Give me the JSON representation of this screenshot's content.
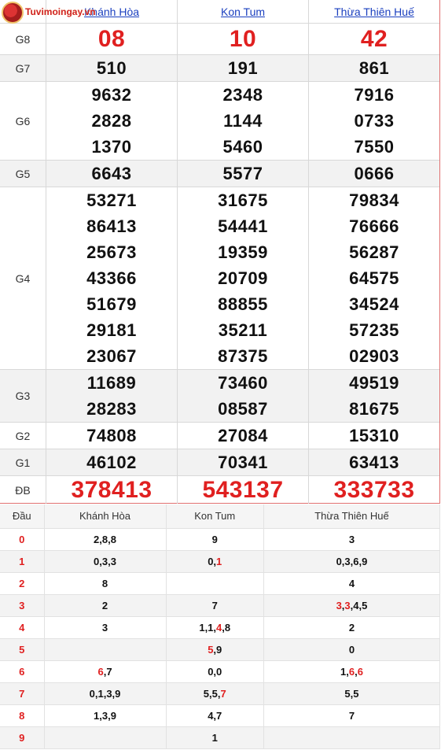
{
  "logo": {
    "text": "Tuvimoingay.vn"
  },
  "provinces": [
    "Khánh Hòa",
    "Kon Tum",
    "Thừa Thiên Huế"
  ],
  "prizes": [
    {
      "label": "G8",
      "values": [
        [
          "08"
        ],
        [
          "10"
        ],
        [
          "42"
        ]
      ]
    },
    {
      "label": "G7",
      "values": [
        [
          "510"
        ],
        [
          "191"
        ],
        [
          "861"
        ]
      ]
    },
    {
      "label": "G6",
      "values": [
        [
          "9632",
          "2828",
          "1370"
        ],
        [
          "2348",
          "1144",
          "5460"
        ],
        [
          "7916",
          "0733",
          "7550"
        ]
      ]
    },
    {
      "label": "G5",
      "values": [
        [
          "6643"
        ],
        [
          "5577"
        ],
        [
          "0666"
        ]
      ]
    },
    {
      "label": "G4",
      "values": [
        [
          "53271",
          "86413",
          "25673",
          "43366",
          "51679",
          "29181",
          "23067"
        ],
        [
          "31675",
          "54441",
          "19359",
          "20709",
          "88855",
          "35211",
          "87375"
        ],
        [
          "79834",
          "76666",
          "56287",
          "64575",
          "34524",
          "57235",
          "02903"
        ]
      ]
    },
    {
      "label": "G3",
      "values": [
        [
          "11689",
          "28283"
        ],
        [
          "73460",
          "08587"
        ],
        [
          "49519",
          "81675"
        ]
      ]
    },
    {
      "label": "G2",
      "values": [
        [
          "74808"
        ],
        [
          "27084"
        ],
        [
          "15310"
        ]
      ]
    },
    {
      "label": "G1",
      "values": [
        [
          "46102"
        ],
        [
          "70341"
        ],
        [
          "63413"
        ]
      ]
    },
    {
      "label": "ĐB",
      "values": [
        [
          "378413"
        ],
        [
          "543137"
        ],
        [
          "333733"
        ]
      ]
    }
  ],
  "dau_table": {
    "header": [
      "Đầu",
      "Khánh Hòa",
      "Kon Tum",
      "Thừa Thiên Huế"
    ],
    "rows": [
      {
        "dau": "0",
        "values": [
          "2,8,8",
          "9",
          "3"
        ]
      },
      {
        "dau": "1",
        "values": [
          "0,3,3",
          "0,1",
          "0,3,6,9"
        ]
      },
      {
        "dau": "2",
        "values": [
          "8",
          "",
          "4"
        ]
      },
      {
        "dau": "3",
        "values": [
          "2",
          "7",
          "3,3,4,5"
        ]
      },
      {
        "dau": "4",
        "values": [
          "3",
          "1,1,4,8",
          "2"
        ]
      },
      {
        "dau": "5",
        "values": [
          "",
          "5,9",
          "0"
        ]
      },
      {
        "dau": "6",
        "values": [
          "6,7",
          "0,0",
          "1,6,6"
        ]
      },
      {
        "dau": "7",
        "values": [
          "0,1,3,9",
          "5,5,7",
          "5,5"
        ]
      },
      {
        "dau": "8",
        "values": [
          "1,3,9",
          "4,7",
          "7"
        ]
      },
      {
        "dau": "9",
        "values": [
          "",
          "1",
          ""
        ]
      }
    ]
  },
  "colors": {
    "accent_red": "#e02020",
    "link_blue": "#1a3fbf"
  }
}
